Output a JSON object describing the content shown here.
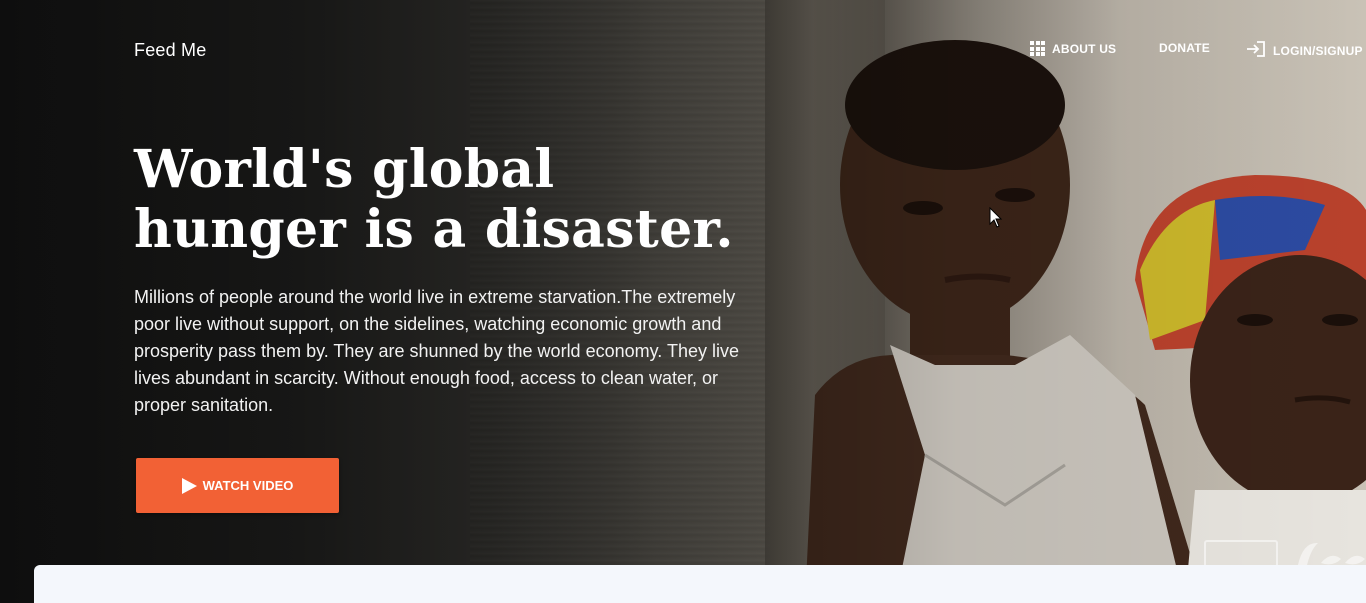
{
  "brand": "Feed Me",
  "nav": {
    "about": "ABOUT US",
    "donate": "DONATE",
    "login": "LOGIN/SIGNUP",
    "about_icon": "apps-grid-icon",
    "login_icon": "login-arrow-icon"
  },
  "hero": {
    "headline_line1": "World's global",
    "headline_line2": "hunger is a disaster.",
    "description": "Millions of people around the world live in extreme starvation.The extremely poor live without support, on the sidelines, watching economic growth and prosperity pass them by. They are shunned by the world economy. They live lives abundant in scarcity. Without enough food, access to clean water, or proper sanitation.",
    "cta_label": "WATCH VIDEO",
    "cta_icon": "play-icon",
    "cta_color": "#f26135"
  }
}
